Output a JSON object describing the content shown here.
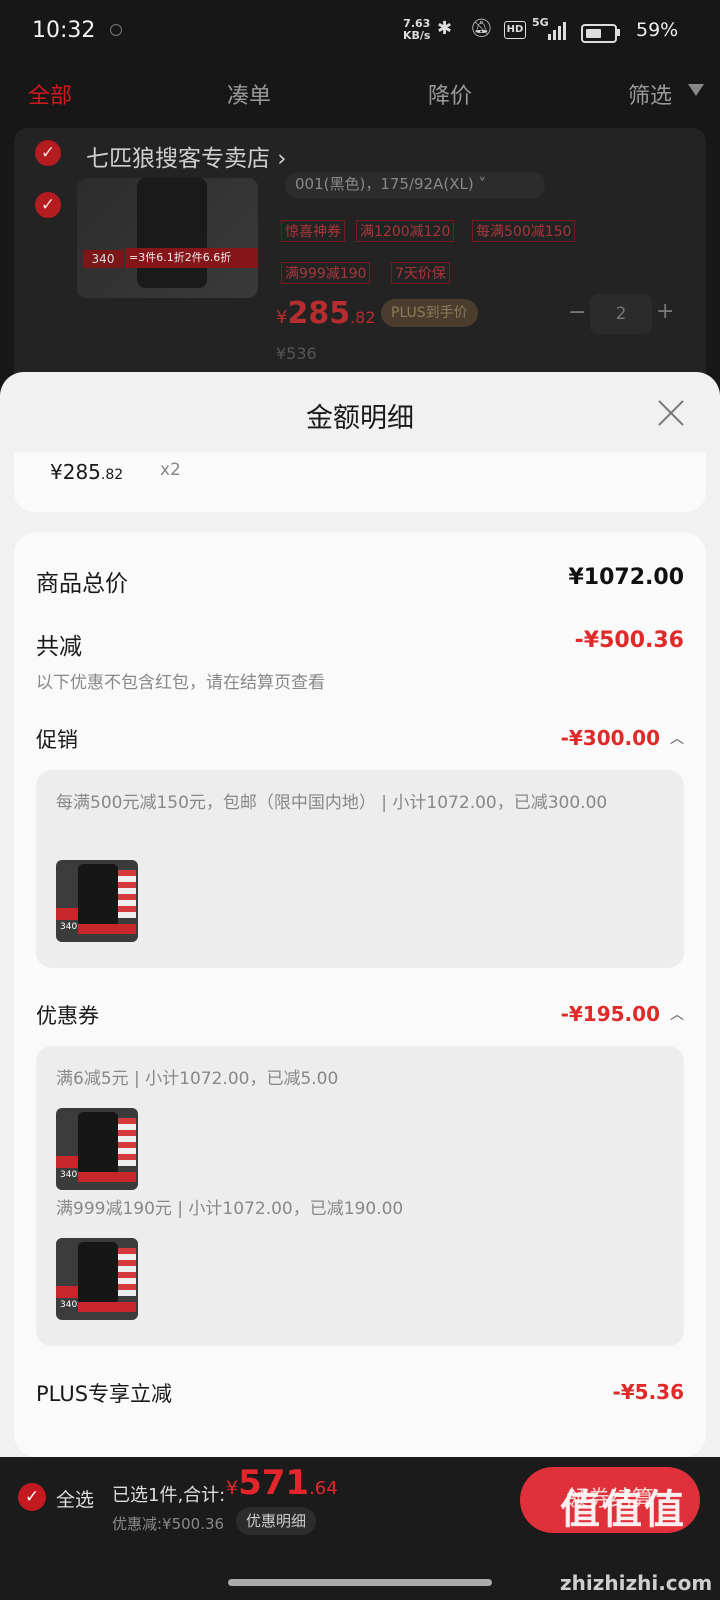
{
  "status": {
    "time": "10:32",
    "speed_value": "7.63",
    "speed_unit": "KB/s",
    "network": "5G",
    "hd": "HD",
    "battery_level": 0.59,
    "battery_pct": "59%"
  },
  "tabs": [
    "全部",
    "凑单",
    "降价",
    "筛选"
  ],
  "cart": {
    "store_name": "七匹狼搜客专卖店 ›",
    "sku": "001(黑色)，175/92A(XL) ˅",
    "promo_tags": [
      "惊喜神券",
      "满1200减120",
      "每满500减150",
      "满999减190",
      "7天价保"
    ],
    "price_currency": "¥",
    "price_int": "285",
    "price_dec": ".82",
    "plus_badge": "PLUS到手价",
    "quantity": "2",
    "original_price": "¥536",
    "thumb_tag": "340",
    "thumb_banner": "=3件6.1折2件6.6折"
  },
  "sheet": {
    "title": "金额明细",
    "unit_price_main": "¥285",
    "unit_price_dec": ".82",
    "unit_qty": "x2",
    "goods_total_label": "商品总价",
    "goods_total": "¥1072.00",
    "total_discount_label": "共减",
    "total_discount": "-¥500.36",
    "note": "以下优惠不包含红包，请在结算页查看",
    "promo_label": "促销",
    "promo_amount": "-¥300.00",
    "promo_detail": "每满500元减150元，包邮（限中国内地） | 小计1072.00，已减300.00",
    "coupon_label": "优惠券",
    "coupon_amount": "-¥195.00",
    "coupon_items": [
      "满6减5元 | 小计1072.00，已减5.00",
      "满999减190元 | 小计1072.00，已减190.00"
    ],
    "plus_label": "PLUS专享立减",
    "plus_amount": "-¥5.36"
  },
  "bottom": {
    "select_all": "全选",
    "selected": "已选1件,合计:",
    "total_currency": "¥",
    "total_int": "571",
    "total_dec": ".64",
    "saved": "优惠减:¥500.36",
    "detail_button": "优惠明细",
    "checkout": "领券结算",
    "watermark": "值值值",
    "watermark_url": "zhizhizhi.com"
  }
}
